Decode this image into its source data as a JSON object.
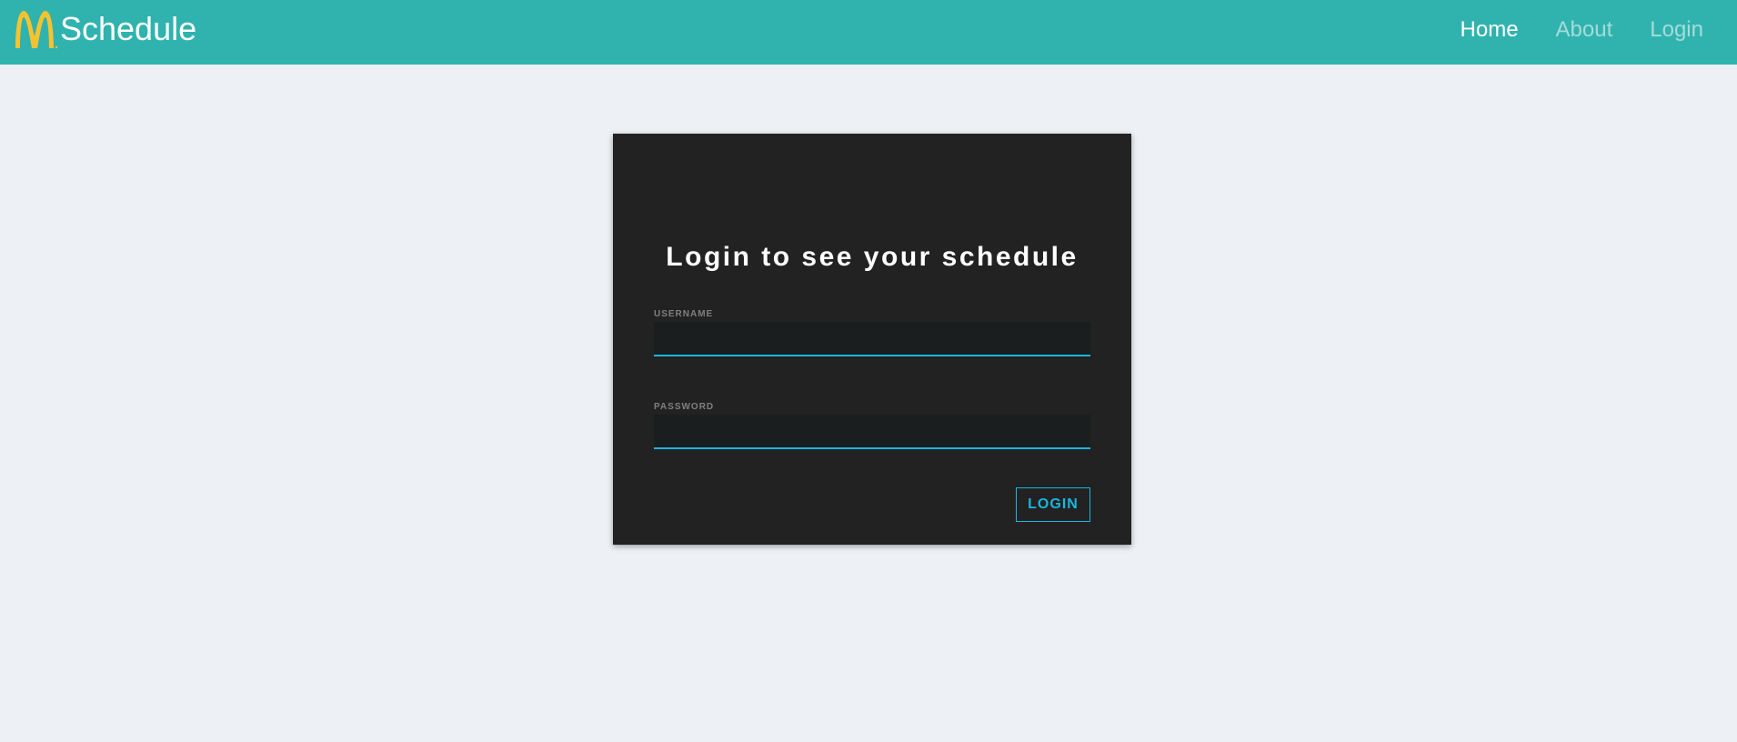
{
  "navbar": {
    "brand_title": "Schedule",
    "brand_logo_icon": "golden-arches-icon",
    "links": [
      {
        "label": "Home",
        "active": true
      },
      {
        "label": "About",
        "active": false
      },
      {
        "label": "Login",
        "active": false
      }
    ],
    "colors": {
      "background": "#30b3ae",
      "logo": "#f6c32f"
    }
  },
  "login_card": {
    "heading": "Login to see your schedule",
    "username": {
      "label": "USERNAME",
      "value": ""
    },
    "password": {
      "label": "PASSWORD",
      "value": ""
    },
    "submit_label": "LOGIN",
    "colors": {
      "background": "#212221",
      "accent": "#1ab6de"
    }
  }
}
